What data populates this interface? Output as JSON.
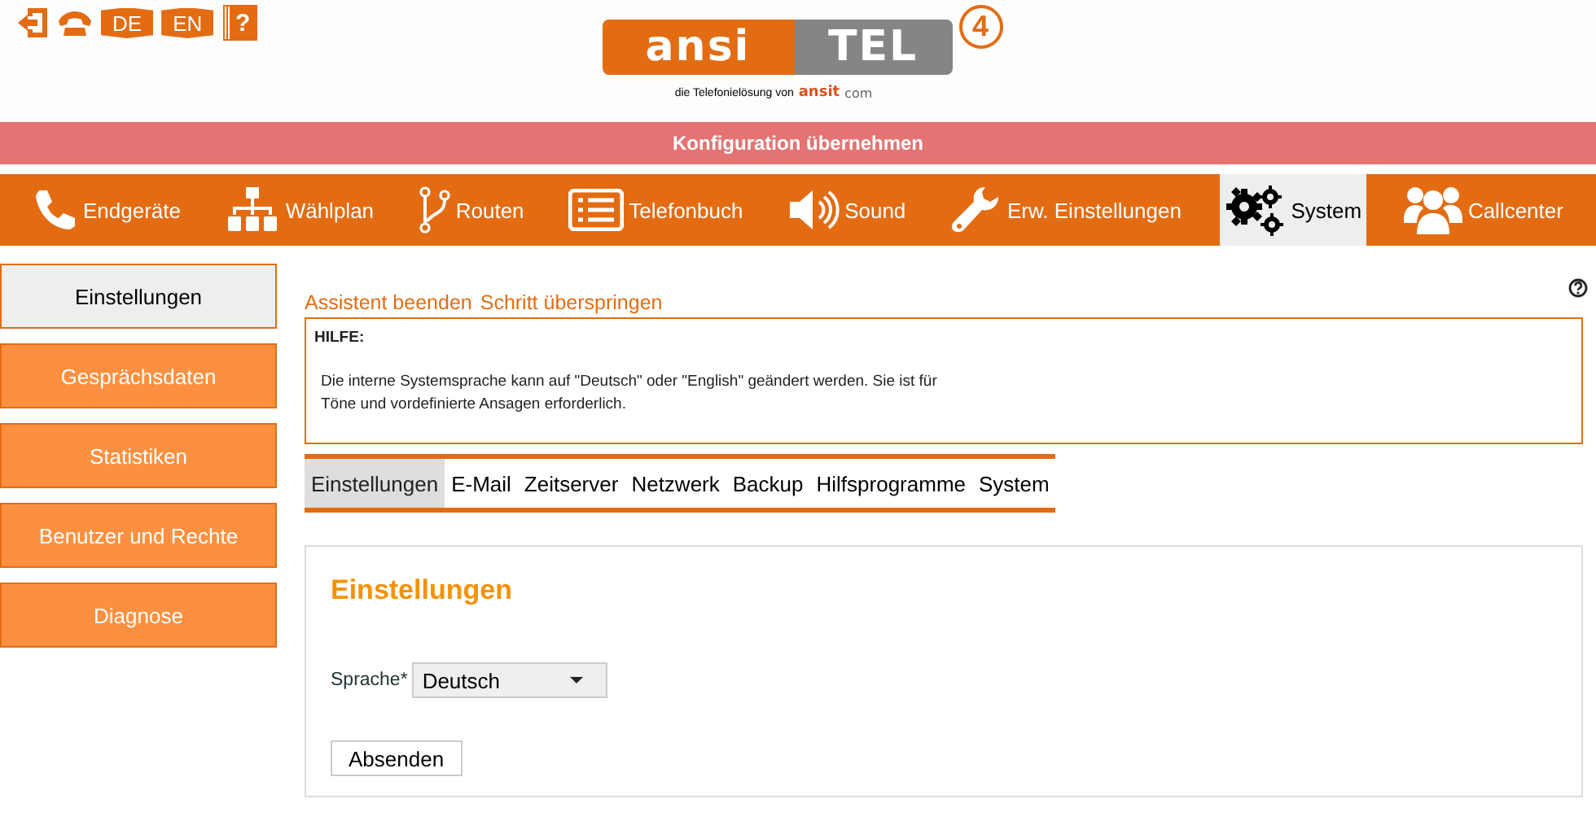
{
  "toolbar": [
    {
      "kind": "exit"
    },
    {
      "kind": "hangup"
    },
    {
      "kind": "flag",
      "label": "DE"
    },
    {
      "kind": "flag",
      "label": "EN"
    },
    {
      "kind": "help",
      "label": "?"
    }
  ],
  "logo": {
    "word_1": "ansi",
    "word_2": "TEL",
    "version": "4",
    "tagline": "die Telefonielösung von",
    "brand_1": "ansit",
    "brand_2": "com"
  },
  "apply_bar": {
    "label": "Konfiguration übernehmen"
  },
  "nav": [
    {
      "kind": "phone",
      "label": "Endgeräte",
      "selected": false
    },
    {
      "kind": "tree",
      "label": "Wählplan",
      "selected": false
    },
    {
      "kind": "route",
      "label": "Routen",
      "selected": false
    },
    {
      "kind": "book",
      "label": "Telefonbuch",
      "selected": false
    },
    {
      "kind": "sound",
      "label": "Sound",
      "selected": false
    },
    {
      "kind": "wrench",
      "label": "Erw. Einstellungen",
      "selected": false
    },
    {
      "kind": "gears",
      "label": "System",
      "selected": true
    },
    {
      "kind": "people",
      "label": "Callcenter",
      "selected": false
    }
  ],
  "sidebar": [
    {
      "label": "Einstellungen",
      "selected": true
    },
    {
      "label": "Gesprächsdaten",
      "selected": false
    },
    {
      "label": "Statistiken",
      "selected": false
    },
    {
      "label": "Benutzer und Rechte",
      "selected": false
    },
    {
      "label": "Diagnose",
      "selected": false
    }
  ],
  "wizard_links": [
    "Assistent beenden",
    "Schritt überspringen"
  ],
  "help": {
    "title": "HILFE:",
    "lines": [
      "Die interne Systemsprache kann auf \"Deutsch\" oder \"English\" geändert werden. Sie ist für",
      "Töne und vordefinierte Ansagen erforderlich."
    ]
  },
  "tabs": [
    {
      "label": "Einstellungen",
      "selected": true
    },
    {
      "label": "E-Mail",
      "selected": false
    },
    {
      "label": "Zeitserver",
      "selected": false
    },
    {
      "label": "Netzwerk",
      "selected": false
    },
    {
      "label": "Backup",
      "selected": false
    },
    {
      "label": "Hilfsprogramme",
      "selected": false
    },
    {
      "label": "System",
      "selected": false
    }
  ],
  "panel": {
    "title": "Einstellungen",
    "field": {
      "label": "Sprache*",
      "value": "Deutsch"
    },
    "submit": "Absenden"
  }
}
